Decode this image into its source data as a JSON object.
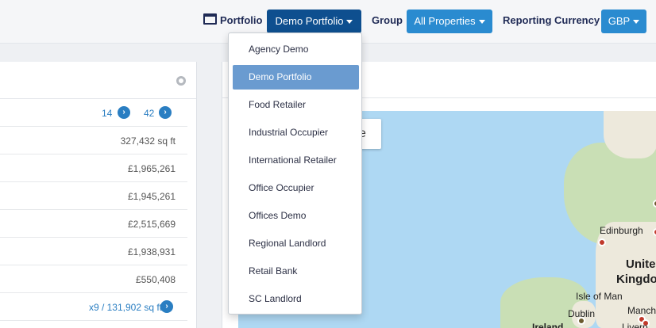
{
  "topbar": {
    "portfolio_label": "Portfolio",
    "portfolio_value": "Demo Portfolio",
    "group_label": "Group",
    "group_value": "All Properties",
    "currency_label": "Reporting Currency",
    "currency_value": "GBP"
  },
  "dropdown": {
    "items": [
      "Agency Demo",
      "Demo Portfolio",
      "Food Retailer",
      "Industrial Occupier",
      "International Retailer",
      "Office Occupier",
      "Offices Demo",
      "Regional Landlord",
      "Retail Bank",
      "SC Landlord"
    ],
    "selected": "Demo Portfolio"
  },
  "summary": {
    "count_a": "14",
    "count_b": "42",
    "rows": [
      "327,432 sq ft",
      "£1,965,261",
      "£1,945,261",
      "£2,515,669",
      "£1,938,931",
      "£550,408",
      "x9 / 131,902 sq ft"
    ]
  },
  "map": {
    "button_text": "e",
    "labels": {
      "edinburgh": "Edinburgh",
      "united": "Unite",
      "kingdom": "Kingdo",
      "isle_of_man": "Isle of Man",
      "dublin": "Dublin",
      "ireland": "Ireland",
      "manchester": "Manch",
      "liverpool": "Liverp"
    }
  },
  "colors": {
    "brand_dark": "#0e4f8f",
    "brand_light": "#2a8bd0",
    "selected_item": "#6a9bd0",
    "water": "#aed8f3"
  }
}
